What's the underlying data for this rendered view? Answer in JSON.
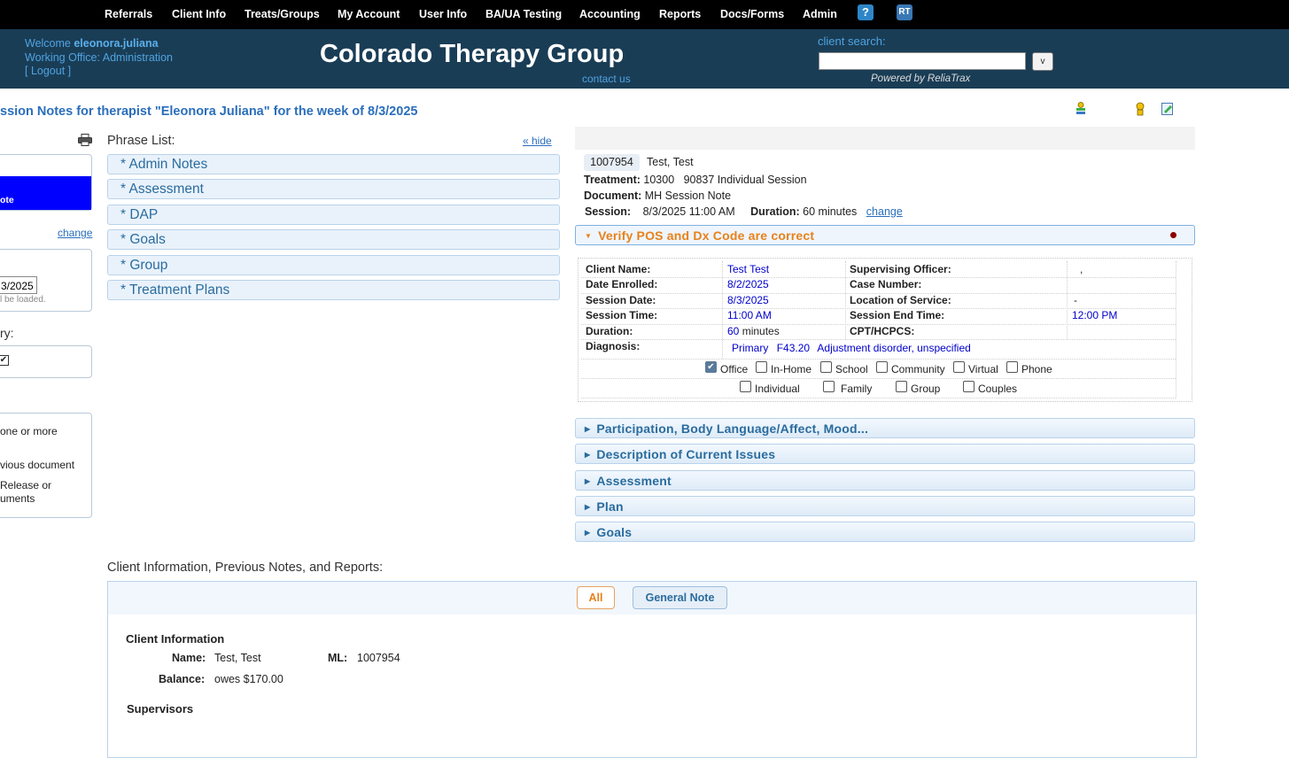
{
  "nav": {
    "items": [
      "Referrals",
      "Client Info",
      "Treats/Groups",
      "My Account",
      "User Info",
      "BA/UA Testing",
      "Accounting",
      "Reports",
      "Docs/Forms",
      "Admin"
    ],
    "help_glyph": "?",
    "rt_glyph": "RT"
  },
  "header": {
    "welcome_prefix": "Welcome",
    "username": "eleonora.juliana",
    "working_office": "Working Office: Administration",
    "logout": "[ Logout ]",
    "org_title": "Colorado Therapy Group",
    "contact": "contact us",
    "search_label": "client search:",
    "search_value": "",
    "search_button": "v",
    "powered_by": "Powered by ReliaTrax"
  },
  "page": {
    "title": "ssion Notes for therapist \"Eleonora Juliana\" for the week of 8/3/2025"
  },
  "left_panel": {
    "selected_item": "ote",
    "change": "change",
    "date_value": "3/2025",
    "date_note": "l be loaded.",
    "section_label": "ry:",
    "info_lines": [
      "one or more",
      "vious document",
      "Release or",
      "uments"
    ]
  },
  "phrase_list": {
    "label": "Phrase List:",
    "hide": "« hide",
    "items": [
      "* Admin Notes",
      "* Assessment",
      "* DAP",
      "* Goals",
      "* Group",
      "* Treatment Plans"
    ]
  },
  "session": {
    "client_id": "1007954",
    "client_name": "Test, Test",
    "treatment_label": "Treatment:",
    "treatment_value": "10300   90837 Individual Session",
    "document_label": "Document:",
    "document_value": "MH Session Note",
    "session_label": "Session:",
    "session_value": "8/3/2025 11:00 AM",
    "duration_label": "Duration:",
    "duration_value": "60 minutes",
    "change": "change"
  },
  "verify": {
    "title": "Verify POS and Dx Code are correct",
    "labels": {
      "client_name": "Client Name:",
      "date_enrolled": "Date Enrolled:",
      "session_date": "Session Date:",
      "session_time": "Session Time:",
      "duration": "Duration:",
      "diagnosis": "Diagnosis:",
      "supervising_officer": "Supervising Officer:",
      "case_number": "Case Number:",
      "location_of_service": "Location of Service:",
      "session_end_time": "Session End Time:",
      "cpt_hcpcs": "CPT/HCPCS:"
    },
    "values": {
      "client_name": "Test Test",
      "date_enrolled": "8/2/2025",
      "session_date": "8/3/2025",
      "session_time": "11:00 AM",
      "duration_num": "60",
      "duration_unit": "minutes",
      "supervising_officer": ",",
      "case_number": "",
      "location_of_service": "-",
      "session_end_time": "12:00 PM",
      "cpt_hcpcs": "",
      "dx_type": "Primary",
      "dx_code": "F43.20",
      "dx_desc": "Adjustment disorder, unspecified"
    },
    "locations": [
      {
        "label": "Office",
        "checked": true
      },
      {
        "label": "In-Home",
        "checked": false
      },
      {
        "label": "School",
        "checked": false
      },
      {
        "label": "Community",
        "checked": false
      },
      {
        "label": "Virtual",
        "checked": false
      },
      {
        "label": "Phone",
        "checked": false
      }
    ],
    "session_types": [
      {
        "label": "Individual",
        "checked": false
      },
      {
        "label": "Family",
        "checked": false
      },
      {
        "label": "Group",
        "checked": false
      },
      {
        "label": "Couples",
        "checked": false
      }
    ]
  },
  "sections": [
    "Participation, Body Language/Affect, Mood...",
    "Description of Current Issues",
    "Assessment",
    "Plan",
    "Goals"
  ],
  "client_info": {
    "label": "Client Information, Previous Notes, and Reports:",
    "tab_all": "All",
    "tab_general": "General Note",
    "heading": "Client Information",
    "name_label": "Name:",
    "name_value": "Test, Test",
    "ml_label": "ML:",
    "ml_value": "1007954",
    "balance_label": "Balance:",
    "balance_value": "owes $170.00",
    "supervisors": "Supervisors"
  },
  "colors": {
    "nav_bg": "#000000",
    "header_bg": "#1a3d56",
    "accent_blue": "#2a6ebb",
    "accent_orange": "#e8811a",
    "selection_blue": "#0000ff"
  }
}
